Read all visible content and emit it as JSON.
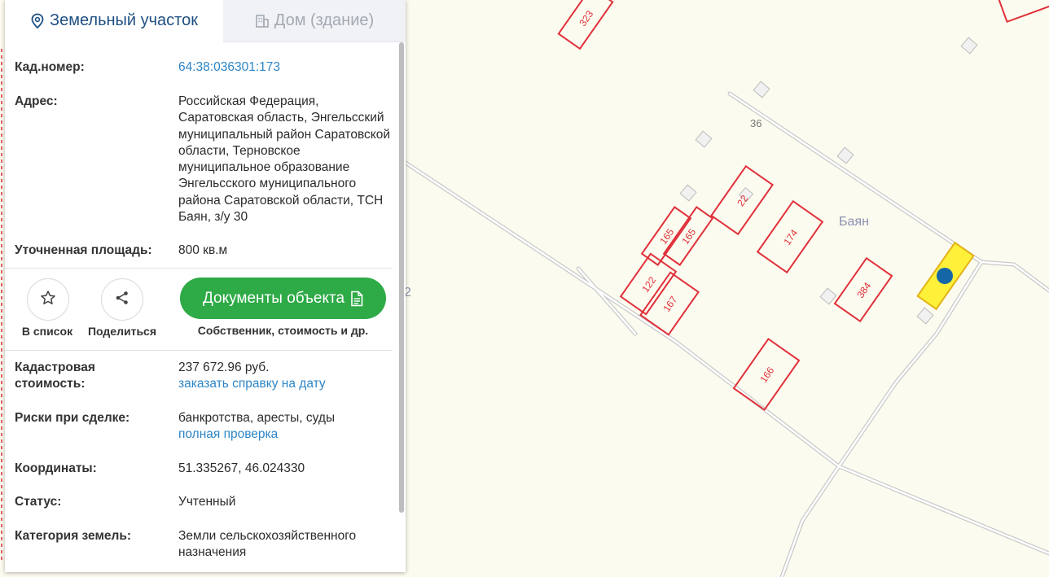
{
  "tabs": {
    "land_label": "Земельный участок",
    "building_label": "Дом (здание)"
  },
  "info": {
    "cad_label": "Кад.номер:",
    "cad_value": "64:38:036301:173",
    "address_label": "Адрес:",
    "address_value": "Российская Федерация, Саратовская область, Энгельсский муниципальный район Саратовской области, Терновское муниципальное образование Энгельсского муниципального района Саратовской области, ТСН Баян, з/у 30",
    "area_label": "Уточненная площадь:",
    "area_value": "800 кв.м"
  },
  "actions": {
    "favorite_label": "В список",
    "share_label": "Поделиться",
    "documents_label": "Документы объекта",
    "documents_sub": "Собственник, стоимость и др."
  },
  "details": {
    "cost_label": "Кадастровая стоимость:",
    "cost_value": "237 672.96 руб.",
    "cost_link": "заказать справку на дату",
    "risks_label": "Риски при сделке:",
    "risks_value": "банкротства, аресты, суды",
    "risks_link": "полная проверка",
    "coords_label": "Координаты:",
    "coords_value": "51.335267, 46.024330",
    "status_label": "Статус:",
    "status_value": "Учтенный",
    "category_label": "Категория земель:",
    "category_value": "Земли сельскохозяйственного назначения"
  },
  "map": {
    "place_label": "Баян",
    "road_label": "36",
    "edge_label": "2",
    "parcels": [
      "323",
      "22",
      "165",
      "165",
      "174",
      "122",
      "167",
      "384",
      "166"
    ]
  },
  "colors": {
    "accent": "#2c85c6",
    "primary_button": "#2eaa47",
    "parcel_border": "#e0303a",
    "selected_parcel": "#fff03a",
    "map_background": "#fcfbef"
  }
}
